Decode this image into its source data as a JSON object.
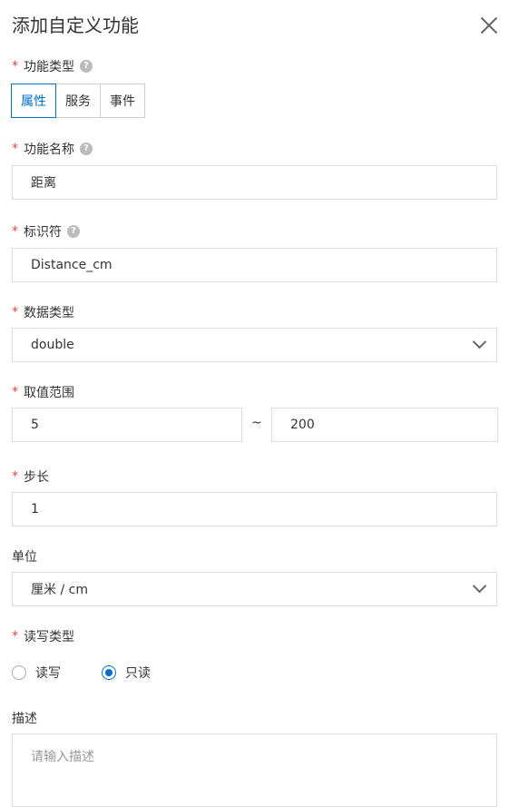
{
  "dialog": {
    "title": "添加自定义功能",
    "close_icon": "close-icon"
  },
  "function_type": {
    "label": "功能类型",
    "options": [
      "属性",
      "服务",
      "事件"
    ],
    "selected": "属性"
  },
  "function_name": {
    "label": "功能名称",
    "value": "距离"
  },
  "identifier": {
    "label": "标识符",
    "value": "Distance_cm"
  },
  "data_type": {
    "label": "数据类型",
    "value": "double"
  },
  "range": {
    "label": "取值范围",
    "min": "5",
    "separator": "~",
    "max": "200"
  },
  "step": {
    "label": "步长",
    "value": "1"
  },
  "unit": {
    "label": "单位",
    "value": "厘米 / cm"
  },
  "rw_type": {
    "label": "读写类型",
    "options": [
      "读写",
      "只读"
    ],
    "selected": "只读"
  },
  "description": {
    "label": "描述",
    "placeholder": "请输入描述"
  },
  "colors": {
    "accent": "#0070cc",
    "required": "#e64545",
    "border": "#dcdcdc"
  }
}
